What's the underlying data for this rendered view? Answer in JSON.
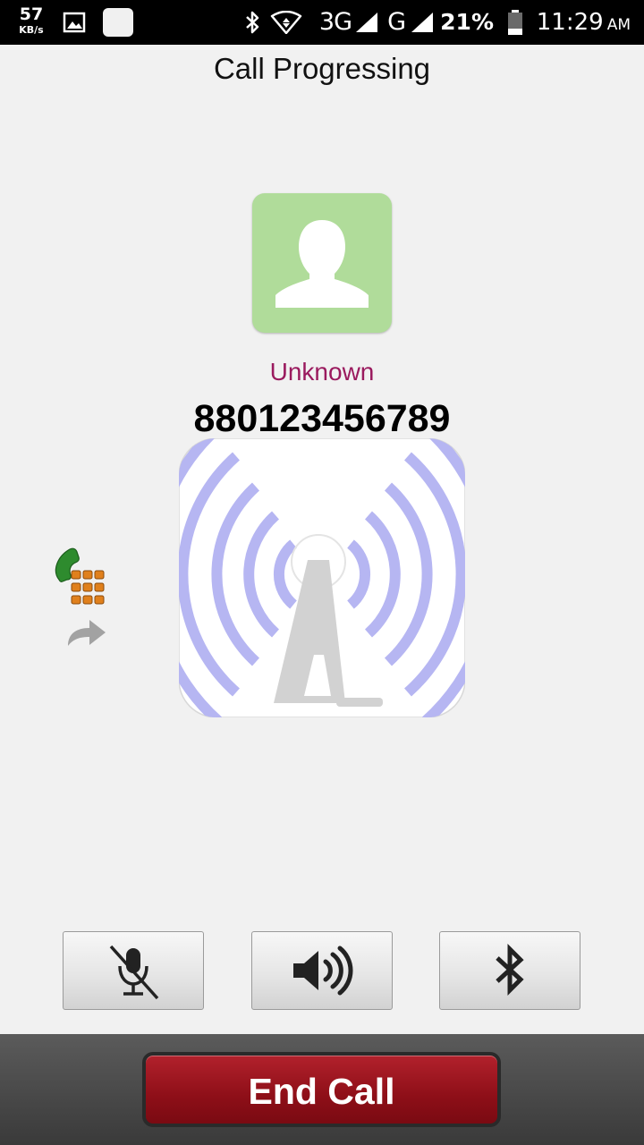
{
  "status_bar": {
    "speed_value": "57",
    "speed_unit": "KB/s",
    "network_primary": "3G",
    "network_secondary": "G",
    "battery": "21%",
    "time": "11:29",
    "ampm": "AM",
    "icons": [
      "gallery-icon",
      "app-icon",
      "bluetooth-icon",
      "wifi-icon",
      "signal-icon",
      "signal-icon",
      "battery-icon"
    ]
  },
  "title": "Call Progressing",
  "caller": {
    "name": "Unknown",
    "number": "880123456789",
    "name_color": "#9a1a5e",
    "avatar_color": "#b0dc9a",
    "avatar_icon": "person-icon"
  },
  "call_graphic": {
    "icon": "signal-tower-icon",
    "wave_color": "#b6b6f2"
  },
  "side_actions": [
    {
      "name": "dialpad",
      "icon": "phone-keypad-icon"
    },
    {
      "name": "forward",
      "icon": "forward-arrow-icon"
    }
  ],
  "controls": [
    {
      "name": "mute",
      "icon": "mic-off-icon"
    },
    {
      "name": "speaker",
      "icon": "speaker-icon"
    },
    {
      "name": "bluetooth",
      "icon": "bluetooth-icon"
    }
  ],
  "end_call": {
    "label": "End Call",
    "color": "#8e0f18"
  }
}
